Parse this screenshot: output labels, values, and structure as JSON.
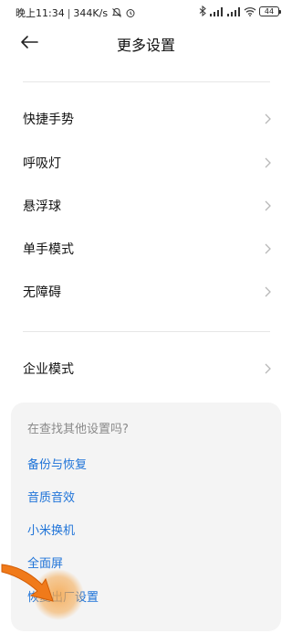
{
  "status": {
    "time": "晚上11:34",
    "speed": "344K/s",
    "battery": "44"
  },
  "header": {
    "title": "更多设置"
  },
  "menu": [
    {
      "label": "快捷手势"
    },
    {
      "label": "呼吸灯"
    },
    {
      "label": "悬浮球"
    },
    {
      "label": "单手模式"
    },
    {
      "label": "无障碍"
    }
  ],
  "enterprise": {
    "label": "企业模式"
  },
  "suggestions": {
    "title": "在查找其他设置吗?",
    "links": [
      "备份与恢复",
      "音质音效",
      "小米换机",
      "全面屏",
      "恢复出厂设置"
    ]
  },
  "colors": {
    "link": "#1e73d8",
    "arrow": "#f07a1a",
    "highlight": "#f5a64a"
  }
}
